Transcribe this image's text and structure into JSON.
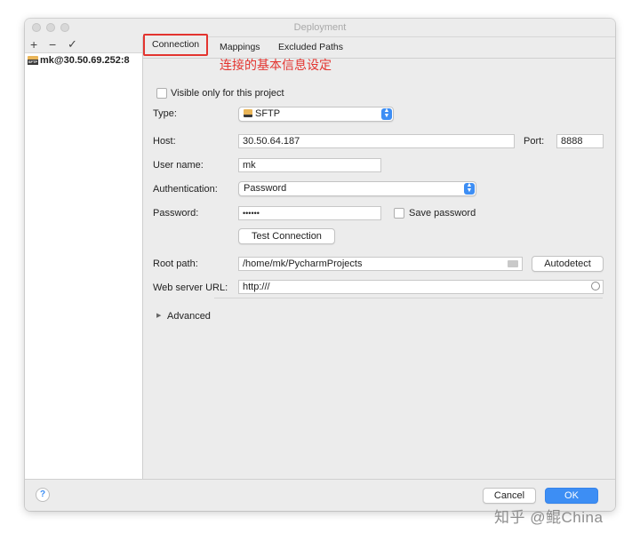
{
  "window": {
    "title": "Deployment"
  },
  "toolbar": {
    "add": "+",
    "remove": "−",
    "apply": "✓"
  },
  "servers": [
    {
      "label": "mk@30.50.69.252:8",
      "icon": "sftp-icon"
    }
  ],
  "tabs": [
    {
      "label": "Connection",
      "active": true
    },
    {
      "label": "Mappings",
      "active": false
    },
    {
      "label": "Excluded Paths",
      "active": false
    }
  ],
  "annotation": "连接的基本信息设定",
  "form": {
    "visible_only_label": "Visible only for this project",
    "visible_only_checked": false,
    "type_label": "Type:",
    "type_value": "SFTP",
    "host_label": "Host:",
    "host_value": "30.50.64.187",
    "port_label": "Port:",
    "port_value": "8888",
    "username_label": "User name:",
    "username_value": "mk",
    "auth_label": "Authentication:",
    "auth_value": "Password",
    "password_label": "Password:",
    "password_value": "••••••",
    "save_password_label": "Save password",
    "save_password_checked": false,
    "test_connection_label": "Test Connection",
    "root_path_label": "Root path:",
    "root_path_value": "/home/mk/PycharmProjects",
    "autodetect_label": "Autodetect",
    "web_url_label": "Web server URL:",
    "web_url_value": "http:///",
    "advanced_label": "Advanced"
  },
  "footer": {
    "help": "?",
    "cancel": "Cancel",
    "ok": "OK"
  },
  "watermark": "知乎 @鲲China",
  "colors": {
    "accent": "#3d8ef4",
    "annotation": "#e3342f"
  }
}
